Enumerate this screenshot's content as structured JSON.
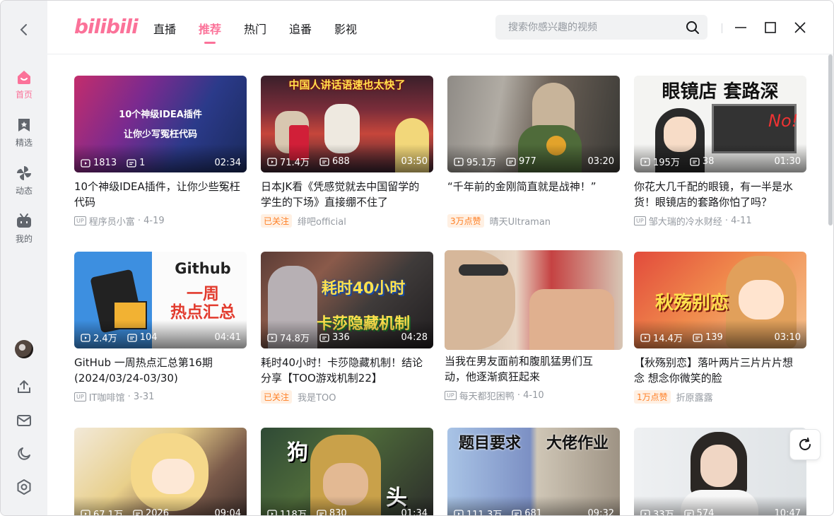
{
  "app": {
    "logo_text": "bilibili"
  },
  "header": {
    "tabs": [
      {
        "label": "直播"
      },
      {
        "label": "推荐",
        "active": true
      },
      {
        "label": "热门"
      },
      {
        "label": "追番"
      },
      {
        "label": "影视"
      }
    ],
    "search_placeholder": "搜索你感兴趣的视频"
  },
  "sidebar": {
    "items": [
      {
        "label": "首页",
        "icon": "home-icon"
      },
      {
        "label": "精选",
        "icon": "bookmark-icon"
      },
      {
        "label": "动态",
        "icon": "pinwheel-icon"
      },
      {
        "label": "我的",
        "icon": "tv-icon"
      }
    ]
  },
  "colors": {
    "accent": "#fb7299",
    "badge_orange": "#ff7f24"
  },
  "videos": [
    {
      "views": "1813",
      "danmaku": "1",
      "duration": "02:34",
      "title": "10个神级IDEA插件，让你少些冤枉代码",
      "author": "程序员小富",
      "date": "4-19",
      "badge": "",
      "overlay": "10个神级IDEA插件\n让你少写冤枉代码"
    },
    {
      "views": "71.4万",
      "danmaku": "688",
      "duration": "03:50",
      "title": "日本JK看《凭感觉就去中国留学的学生的下场》直接绷不住了",
      "author": "绯吧official",
      "date": "",
      "badge": "已关注",
      "overlay": "中国人讲话语速也太快了"
    },
    {
      "views": "95.1万",
      "danmaku": "977",
      "duration": "03:20",
      "title": "“千年前的金刚简直就是战神！”",
      "author": "晴天Ultraman",
      "date": "",
      "badge": "3万点赞",
      "overlay": ""
    },
    {
      "views": "195万",
      "danmaku": "38",
      "duration": "01:30",
      "title": "你花大几千配的眼镜，有一半是水货！眼镜店的套路你怕了吗？",
      "author": "邹大瑞的冷水财经",
      "date": "4-11",
      "badge": "",
      "overlay": "眼镜店 套路深"
    },
    {
      "views": "2.4万",
      "danmaku": "104",
      "duration": "04:41",
      "title": "GitHub 一周热点汇总第16期(2024/03/24-03/30)",
      "author": "IT咖啡馆",
      "date": "3-31",
      "badge": "",
      "overlay": "Github\n一周\n热点汇总"
    },
    {
      "views": "74.8万",
      "danmaku": "336",
      "duration": "04:28",
      "title": "耗时40小时！卡莎隐藏机制！结论分享【TOO游戏机制22】",
      "author": "我是TOO",
      "date": "",
      "badge": "已关注",
      "overlay": "耗时40小时\n卡莎隐藏机制"
    },
    {
      "views": "",
      "danmaku": "",
      "duration": "",
      "title": "当我在男友面前和腹肌猛男们互动，他逐渐疯狂起来",
      "author": "每天都犯困鸭",
      "date": "4-10",
      "badge": "",
      "overlay": ""
    },
    {
      "views": "14.4万",
      "danmaku": "139",
      "duration": "03:10",
      "title": "【秋殇别恋】落叶两片三片片片想念 想念你微笑的脸",
      "author": "折原露露",
      "date": "",
      "badge": "1万点赞",
      "overlay": "秋殇别恋"
    },
    {
      "views": "67.1万",
      "danmaku": "2026",
      "duration": "09:04",
      "title": "",
      "author": "",
      "date": "",
      "badge": "",
      "overlay": ""
    },
    {
      "views": "118万",
      "danmaku": "830",
      "duration": "01:34",
      "title": "",
      "author": "",
      "date": "",
      "badge": "",
      "overlay": "狗\n头"
    },
    {
      "views": "111.3万",
      "danmaku": "681",
      "duration": "09:32",
      "title": "",
      "author": "",
      "date": "",
      "badge": "",
      "overlay": "题目要求 大佬作业"
    },
    {
      "views": "33万",
      "danmaku": "574",
      "duration": "10:47",
      "title": "",
      "author": "",
      "date": "",
      "badge": "",
      "overlay": ""
    }
  ]
}
